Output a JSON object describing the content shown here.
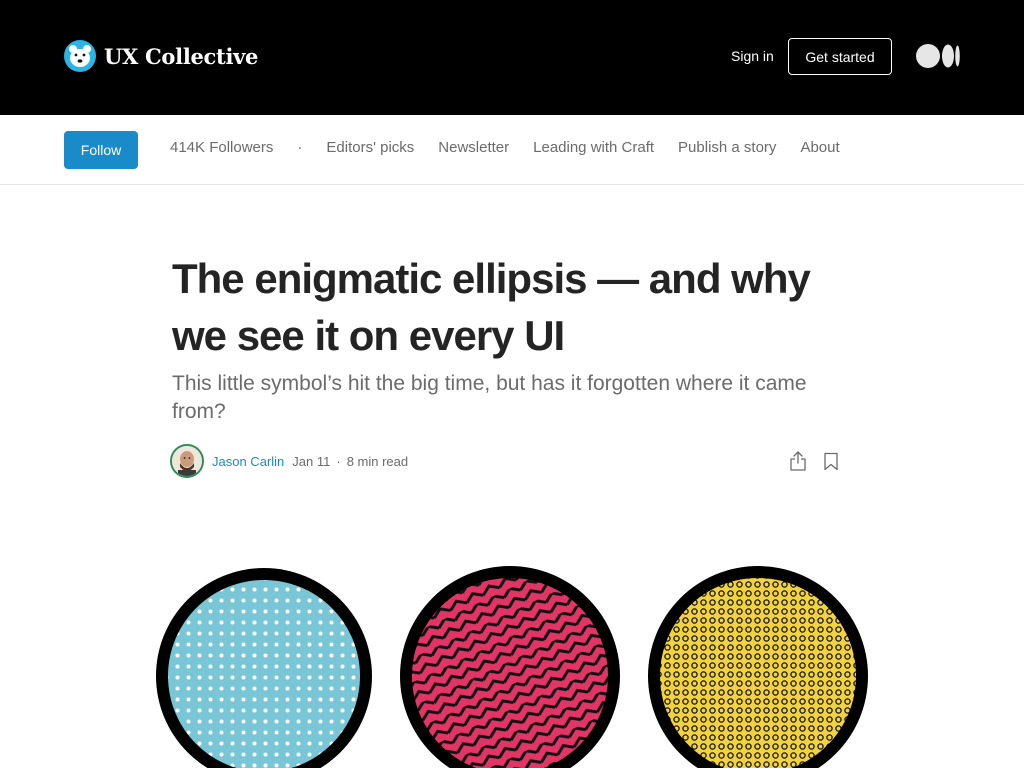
{
  "topbar": {
    "brand_name": "UX Collective",
    "sign_in": "Sign in",
    "get_started": "Get started",
    "colors": {
      "background": "#000000",
      "text": "#ffffff"
    }
  },
  "pubnav": {
    "follow": "Follow",
    "followers": "414K Followers",
    "separator": "·",
    "links": [
      "Editors' picks",
      "Newsletter",
      "Leading with Craft",
      "Publish a story",
      "About"
    ],
    "colors": {
      "follow_bg": "#1a8bc9"
    }
  },
  "article": {
    "title": "The enigmatic ellipsis — and why we see it on every UI",
    "subtitle": "This little symbol’s hit the big time, but has it forgotten where it came from?",
    "author": "Jason Carlin",
    "date": "Jan 11",
    "separator": "·",
    "read_time": "8 min read",
    "icons": [
      "share-icon",
      "bookmark-icon"
    ]
  },
  "hero": {
    "circles": [
      {
        "name": "blue-dot-circle",
        "color": "#78c6d6"
      },
      {
        "name": "pink-zigzag-circle",
        "color": "#e23566"
      },
      {
        "name": "yellow-ring-circle",
        "color": "#f2d33f"
      }
    ]
  }
}
